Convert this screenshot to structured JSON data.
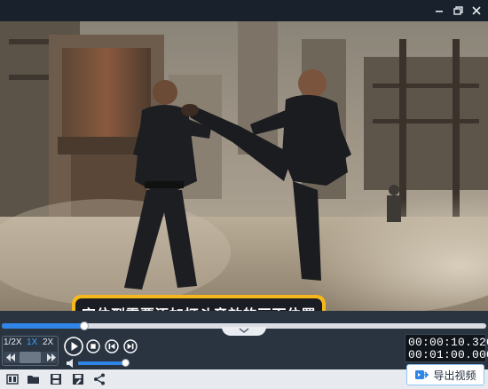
{
  "window": {
    "controls": [
      {
        "name": "minimize-icon"
      },
      {
        "name": "restore-icon"
      },
      {
        "name": "close-icon"
      }
    ]
  },
  "video": {
    "tooltip": "定位到需要添加打斗音效的画面位置",
    "scene": "two martial artists in black uniforms fighting in a dusty industrial site"
  },
  "playback": {
    "speed_options": [
      "1/2X",
      "1X",
      "2X"
    ],
    "active_speed": "1X",
    "progress_fraction": 0.17,
    "volume_fraction": 0.96,
    "current_time": "00:00:10.320",
    "total_time": "00:01:00.000"
  },
  "toolbar": {
    "tools": [
      "film-edit-icon",
      "folder-open-icon",
      "save-icon",
      "save-as-icon",
      "share-icon"
    ],
    "export_label": "导出视频"
  },
  "colors": {
    "accent": "#2f86e8",
    "tooltip_border": "#f4b81d",
    "panel": "#2a3441"
  }
}
